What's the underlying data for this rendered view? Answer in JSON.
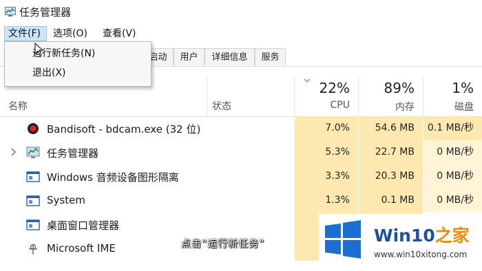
{
  "window": {
    "title": "任务管理器"
  },
  "menu": [
    {
      "label": "文件(F)",
      "active": true
    },
    {
      "label": "选项(O)"
    },
    {
      "label": "查看(V)"
    }
  ],
  "file_menu": {
    "items": [
      {
        "label": "运行新任务(N)"
      },
      {
        "label": "退出(X)"
      }
    ]
  },
  "tabs": [
    {
      "label": "启动"
    },
    {
      "label": "用户"
    },
    {
      "label": "详细信息"
    },
    {
      "label": "服务"
    }
  ],
  "columns": {
    "name": "名称",
    "status": "状态",
    "cpu": {
      "percent": "22%",
      "label": "CPU"
    },
    "memory": {
      "percent": "89%",
      "label": "内存"
    },
    "disk": {
      "percent": "1%",
      "label": "磁盘"
    }
  },
  "processes": [
    {
      "name": "Bandisoft - bdcam.exe (32 位)",
      "icon": "bandicam-record-icon",
      "cpu": "7.0%",
      "memory": "54.6 MB",
      "disk": "0.1 MB/秒"
    },
    {
      "name": "任务管理器",
      "icon": "task-manager-icon",
      "cpu": "5.3%",
      "memory": "22.7 MB",
      "disk": "0 MB/秒"
    },
    {
      "name": "Windows 音频设备图形隔离",
      "icon": "service-window-icon",
      "cpu": "3.3%",
      "memory": "20.3 MB",
      "disk": "0 MB/秒"
    },
    {
      "name": "System",
      "icon": "service-window-icon",
      "cpu": "1.3%",
      "memory": "0.1 MB",
      "disk": "0 MB/秒"
    },
    {
      "name": "桌面窗口管理器",
      "icon": "service-window-icon",
      "cpu": "",
      "memory": "",
      "disk": ""
    },
    {
      "name": "Microsoft IME",
      "icon": "ime-icon",
      "cpu": "",
      "memory": "",
      "disk": ""
    }
  ],
  "subtitle": "点击“运行新任务”",
  "watermark": {
    "brand_prefix": "Win10",
    "brand_suffix": "之家",
    "site": "www.win10xitong.com"
  },
  "colors": {
    "heat_high": "#fde9b0",
    "heat_low": "#fff4d6",
    "menu_active": "#cce4f7",
    "brand_blue": "#1c6fd1"
  }
}
